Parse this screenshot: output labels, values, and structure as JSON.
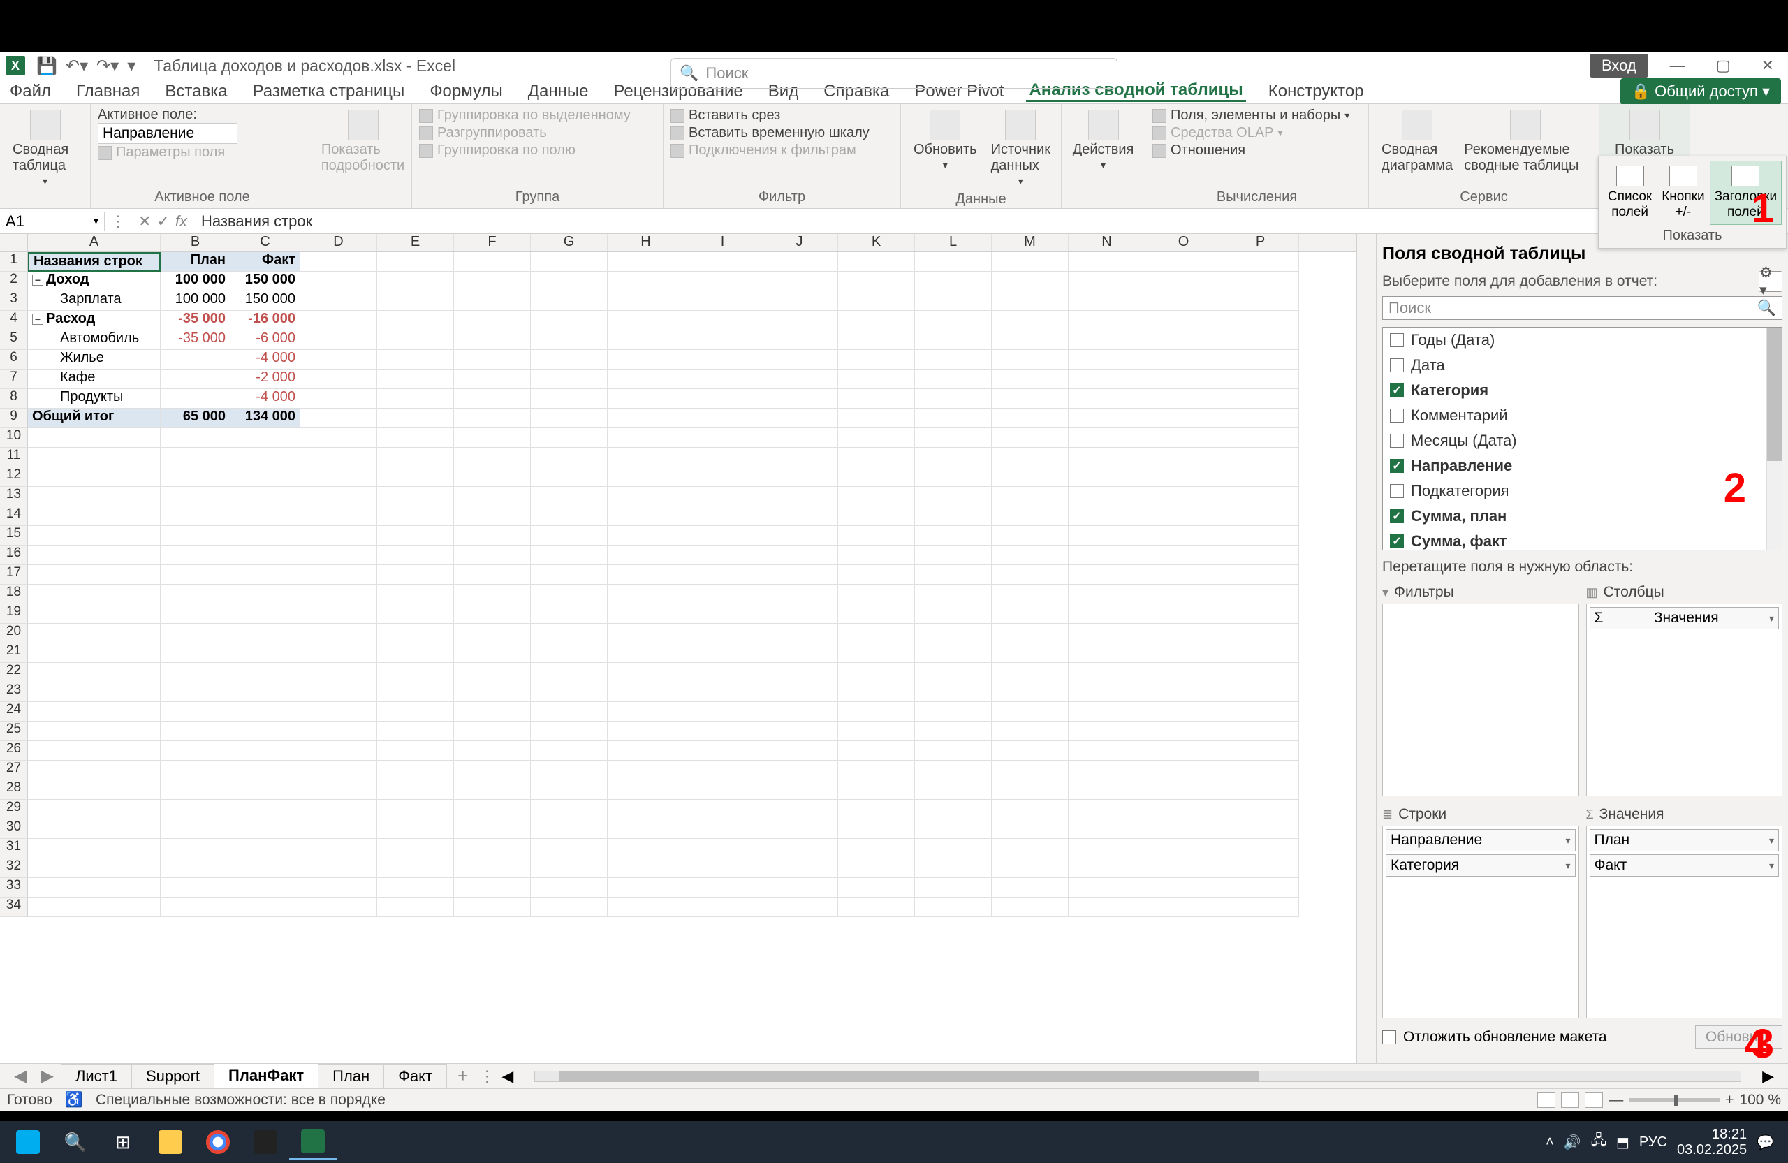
{
  "titlebar": {
    "doc_name": "Таблица доходов и расходов.xlsx  -  Excel",
    "search_placeholder": "Поиск",
    "login": "Вход"
  },
  "ribbon_tabs": {
    "file": "Файл",
    "home": "Главная",
    "insert": "Вставка",
    "layout": "Разметка страницы",
    "formulas": "Формулы",
    "data": "Данные",
    "review": "Рецензирование",
    "view": "Вид",
    "help": "Справка",
    "powerpivot": "Power Pivot",
    "analyze": "Анализ сводной таблицы",
    "design": "Конструктор",
    "share": "Общий доступ"
  },
  "ribbon": {
    "pivot": "Сводная таблица",
    "active_field_group": "Активное поле",
    "active_field_label": "Активное поле:",
    "active_field_value": "Направление",
    "field_settings": "Параметры поля",
    "show_details": "Показать подробности",
    "group": "Группа",
    "group_sel": "Группировка по выделенному",
    "ungroup": "Разгруппировать",
    "group_field": "Группировка по полю",
    "filter": "Фильтр",
    "insert_slicer": "Вставить срез",
    "insert_timeline": "Вставить временную шкалу",
    "filter_connections": "Подключения к фильтрам",
    "data_group": "Данные",
    "refresh": "Обновить",
    "change_source": "Источник данных",
    "actions": "Действия",
    "calculations": "Вычисления",
    "fields_items": "Поля, элементы и наборы",
    "olap": "Средства OLAP",
    "relationships": "Отношения",
    "tools": "Сервис",
    "pivotchart": "Сводная диаграмма",
    "recommended": "Рекомендуемые сводные таблицы",
    "show": "Показать"
  },
  "show_popup": {
    "field_list": "Список полей",
    "buttons": "Кнопки +/-",
    "headers": "Заголовки полей",
    "label": "Показать"
  },
  "formula_bar": {
    "name_box": "A1",
    "formula": "Названия строк"
  },
  "columns": [
    "A",
    "B",
    "C",
    "D",
    "E",
    "F",
    "G",
    "H",
    "I",
    "J",
    "K",
    "L",
    "M",
    "N",
    "O",
    "P"
  ],
  "rownums": [
    "1",
    "2",
    "3",
    "4",
    "5",
    "6",
    "7",
    "8",
    "9",
    "10",
    "11",
    "12",
    "13",
    "14",
    "15",
    "16",
    "17",
    "18",
    "19",
    "20",
    "21",
    "22",
    "23",
    "24",
    "25",
    "26",
    "27",
    "28",
    "29",
    "30",
    "31",
    "32",
    "33",
    "34"
  ],
  "pivot": {
    "h_rows": "Названия строк",
    "h_plan": "План",
    "h_fact": "Факт",
    "r1": {
      "a": "Доход",
      "b": "100 000",
      "c": "150 000"
    },
    "r2": {
      "a": "Зарплата",
      "b": "100 000",
      "c": "150 000"
    },
    "r3": {
      "a": "Расход",
      "b": "-35 000",
      "c": "-16 000"
    },
    "r4": {
      "a": "Автомобиль",
      "b": "-35 000",
      "c": "-6 000"
    },
    "r5": {
      "a": "Жилье",
      "b": "",
      "c": "-4 000"
    },
    "r6": {
      "a": "Кафе",
      "b": "",
      "c": "-2 000"
    },
    "r7": {
      "a": "Продукты",
      "b": "",
      "c": "-4 000"
    },
    "total": {
      "a": "Общий итог",
      "b": "65 000",
      "c": "134 000"
    }
  },
  "field_pane": {
    "title": "Поля сводной таблицы",
    "choose": "Выберите поля для добавления в отчет:",
    "search": "Поиск",
    "fields": {
      "f0": "Годы (Дата)",
      "f1": "Дата",
      "f2": "Категория",
      "f3": "Комментарий",
      "f4": "Месяцы (Дата)",
      "f5": "Направление",
      "f6": "Подкатегория",
      "f7": "Сумма, план",
      "f8": "Сумма, факт"
    },
    "drag": "Перетащите поля в нужную область:",
    "filters": "Фильтры",
    "columns": "Столбцы",
    "rows": "Строки",
    "values": "Значения",
    "col_values": "Значения",
    "row_item1": "Направление",
    "row_item2": "Категория",
    "val_item1": "План",
    "val_item2": "Факт",
    "defer": "Отложить обновление макета",
    "update": "Обновить"
  },
  "annotations": {
    "a1": "1",
    "a2": "2",
    "a3": "3",
    "a4": "4"
  },
  "sheets": {
    "s1": "Лист1",
    "s2": "Support",
    "s3": "ПланФакт",
    "s4": "План",
    "s5": "Факт"
  },
  "statusbar": {
    "ready": "Готово",
    "accessibility": "Специальные возможности: все в порядке",
    "zoom": "100 %"
  },
  "taskbar": {
    "lang": "РУС",
    "time": "18:21",
    "date": "03.02.2025"
  }
}
